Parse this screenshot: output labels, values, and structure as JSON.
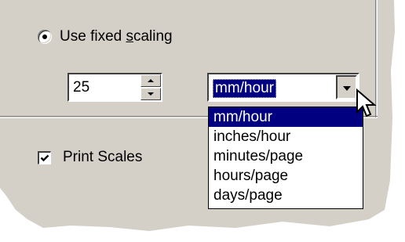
{
  "scaling": {
    "fixed_scaling_label_pre": "Use fixed ",
    "fixed_scaling_label_key": "s",
    "fixed_scaling_label_post": "caling",
    "fixed_scaling_selected": true
  },
  "spinner": {
    "value": "25"
  },
  "units": {
    "selected_value": "mm/hour",
    "options": [
      "mm/hour",
      "inches/hour",
      "minutes/page",
      "hours/page",
      "days/page"
    ],
    "highlighted_index": 0
  },
  "print_scales": {
    "label": "Print Scales",
    "checked": true
  },
  "icons": {
    "cursor": "arrow-cursor-icon",
    "dropdown": "chevron-down-icon",
    "spin_up": "triangle-up-icon",
    "spin_down": "triangle-down-icon",
    "check": "checkmark-icon"
  },
  "colors": {
    "dialog_face": "#d4d0c8",
    "selection": "#000080",
    "background": "#ffffff"
  }
}
